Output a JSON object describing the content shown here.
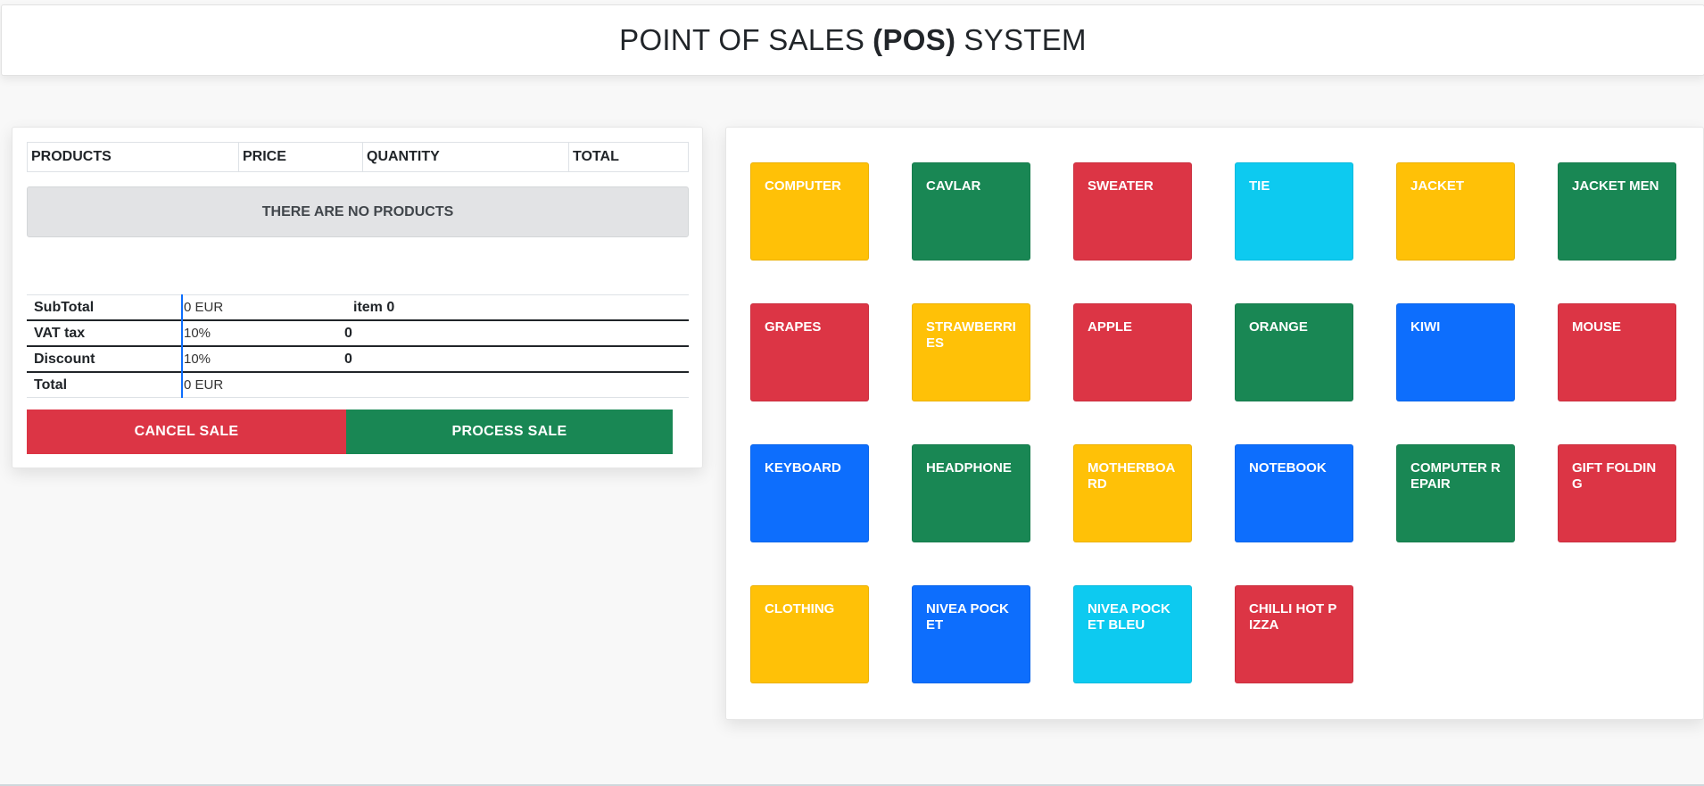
{
  "header": {
    "title_pre": "POINT OF SALES",
    "title_bold": "(POS)",
    "title_post": "SYSTEM"
  },
  "cart": {
    "columns": [
      "PRODUCTS",
      "PRICE",
      "QUANTITY",
      "TOTAL"
    ],
    "empty_message": "THERE ARE NO PRODUCTS",
    "summary": {
      "subtotal_label": "SubTotal",
      "subtotal_value": "0 EUR",
      "item_count": "item 0",
      "vat_label": "VAT tax",
      "vat_value": "10%",
      "vat_amount": "0",
      "discount_label": "Discount",
      "discount_value": "10%",
      "discount_amount": "0",
      "total_label": "Total",
      "total_value": "0 EUR"
    },
    "cancel_label": "CANCEL SALE",
    "process_label": "PROCESS SALE"
  },
  "colors": {
    "warning": "#ffc107",
    "success": "#198754",
    "danger": "#dc3545",
    "info": "#0dcaf0",
    "primary": "#0d6efd"
  },
  "products": [
    {
      "name": "COMPUTER",
      "color": "warning"
    },
    {
      "name": "CAVLAR",
      "color": "success"
    },
    {
      "name": "SWEATER",
      "color": "danger"
    },
    {
      "name": "TIE",
      "color": "info"
    },
    {
      "name": "JACKET",
      "color": "warning"
    },
    {
      "name": "JACKET MEN",
      "color": "success"
    },
    {
      "name": "GRAPES",
      "color": "danger"
    },
    {
      "name": "STRAWBERRIES",
      "color": "warning"
    },
    {
      "name": "APPLE",
      "color": "danger"
    },
    {
      "name": "ORANGE",
      "color": "success"
    },
    {
      "name": "KIWI",
      "color": "primary"
    },
    {
      "name": "MOUSE",
      "color": "danger"
    },
    {
      "name": "KEYBOARD",
      "color": "primary"
    },
    {
      "name": "HEADPHONE",
      "color": "success"
    },
    {
      "name": "MOTHERBOARD",
      "color": "warning"
    },
    {
      "name": "NOTEBOOK",
      "color": "primary"
    },
    {
      "name": "COMPUTER REPAIR",
      "color": "success"
    },
    {
      "name": "GIFT FOLDING",
      "color": "danger"
    },
    {
      "name": "CLOTHING",
      "color": "warning"
    },
    {
      "name": "NIVEA POCKET",
      "color": "primary"
    },
    {
      "name": "NIVEA POCKET BLEU",
      "color": "info"
    },
    {
      "name": "CHILLI HOT PIZZA",
      "color": "danger"
    }
  ]
}
